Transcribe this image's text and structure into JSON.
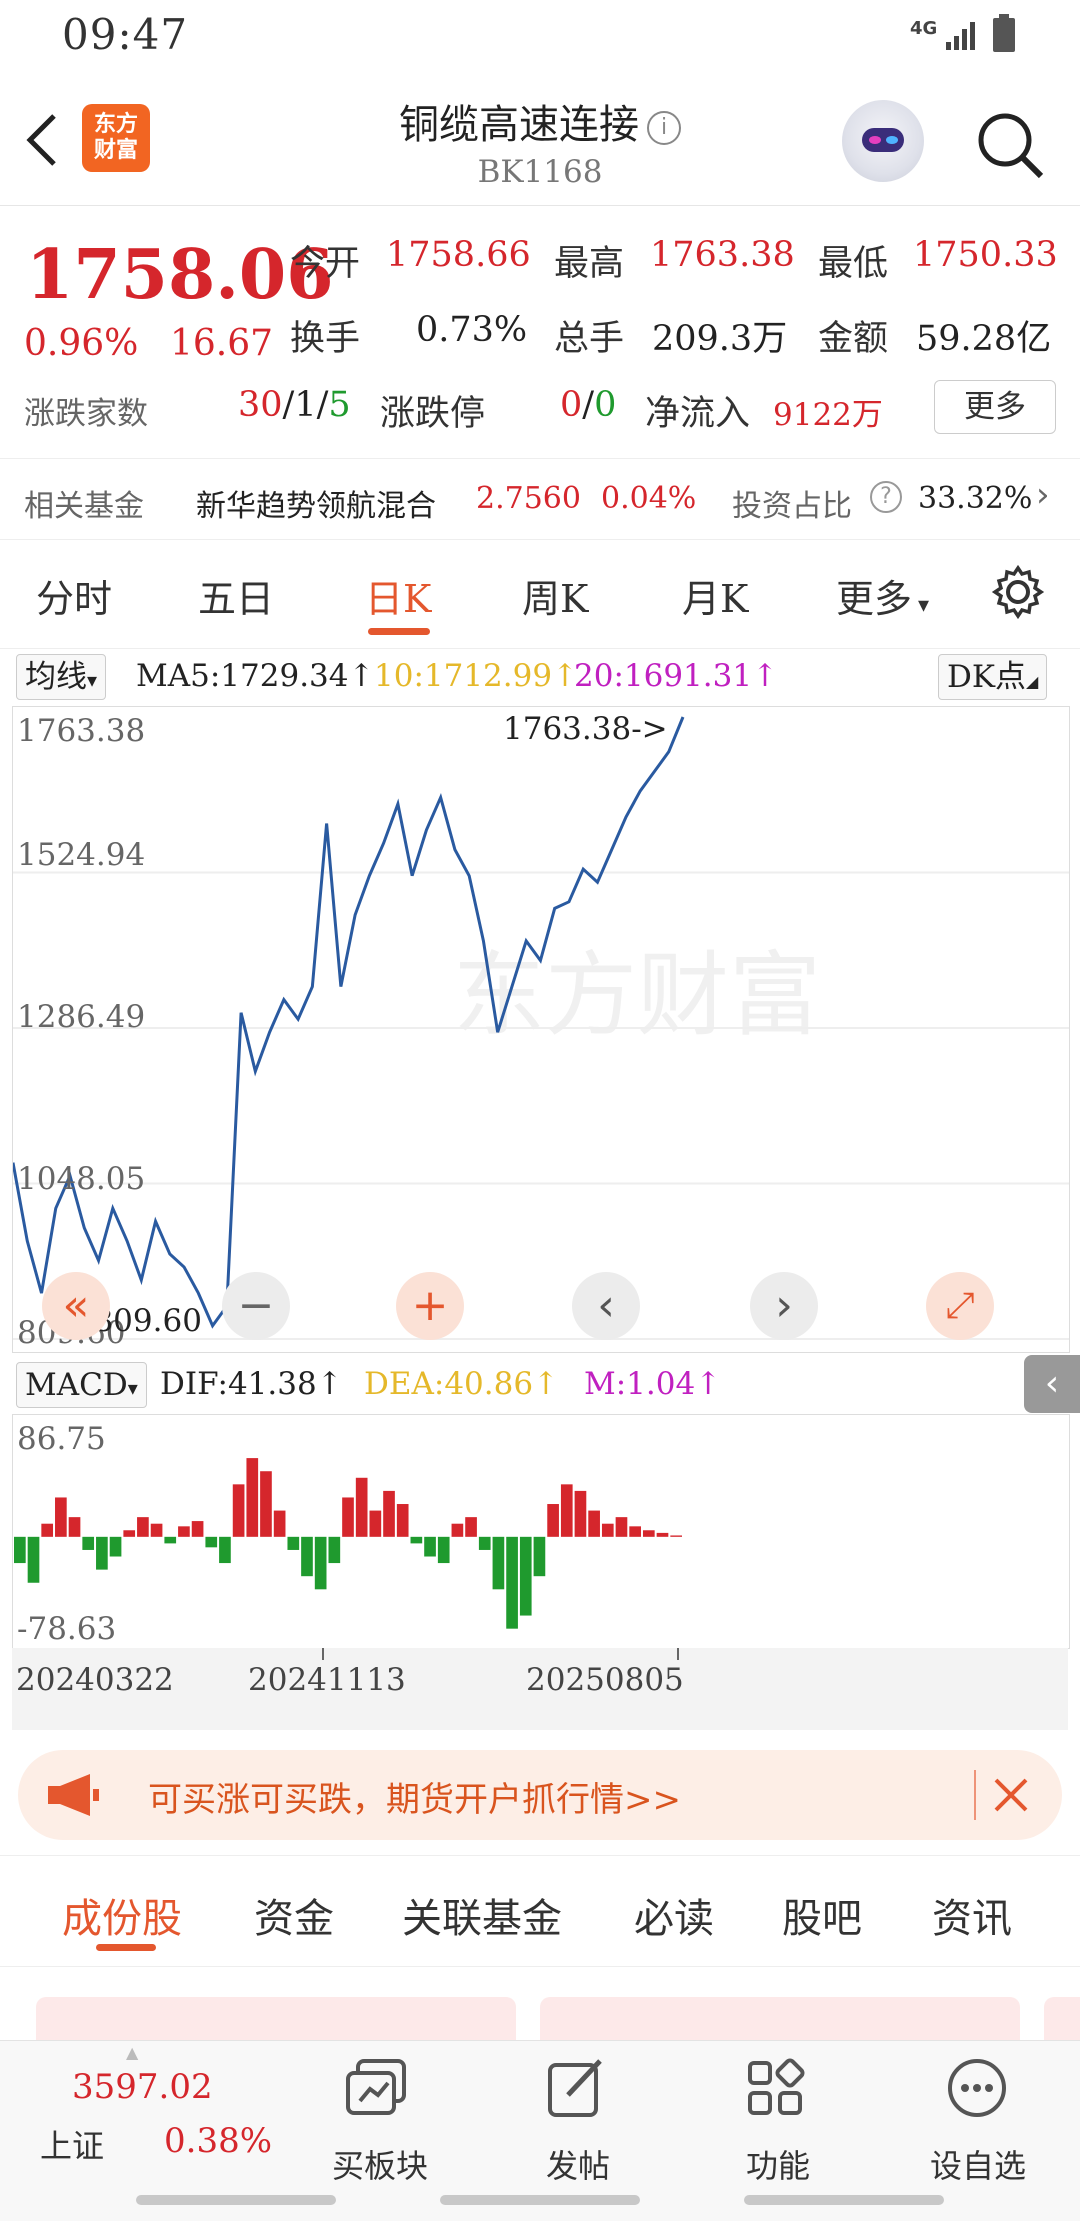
{
  "status": {
    "time": "09:47",
    "network": "4G"
  },
  "header": {
    "title": "铜缆高速连接",
    "code": "BK1168",
    "logo_line1": "东方",
    "logo_line2": "财富"
  },
  "quote": {
    "price": "1758.06",
    "change_pct": "0.96%",
    "change": "16.67",
    "open_label": "今开",
    "open": "1758.66",
    "high_label": "最高",
    "high": "1763.38",
    "low_label": "最低",
    "low": "1750.33",
    "turnover_label": "换手",
    "turnover": "0.73%",
    "volume_label": "总手",
    "volume": "209.3万",
    "amount_label": "金额",
    "amount": "59.28亿",
    "breadth_label": "涨跌家数",
    "breadth_up": "30",
    "breadth_flat": "1",
    "breadth_down": "5",
    "limit_label": "涨跌停",
    "limit_up": "0",
    "limit_down": "0",
    "netflow_label": "净流入",
    "netflow": "9122万",
    "more_label": "更多"
  },
  "fund": {
    "label": "相关基金",
    "name": "新华趋势领航混合",
    "nav": "2.7560",
    "pct": "0.04%",
    "ratio_label": "投资占比",
    "ratio": "33.32%"
  },
  "chart_tabs": [
    "分时",
    "五日",
    "日K",
    "周K",
    "月K",
    "更多"
  ],
  "ma": {
    "select": "均线",
    "ma5": "MA5:1729.34↑",
    "ma10": "10:1712.99↑",
    "ma20": "20:1691.31↑",
    "dk": "DK点"
  },
  "colors": {
    "up": "#d5262c",
    "down": "#1f9a2e",
    "line": "#2a5aa0",
    "ma10": "#e5b82a",
    "accent": "#e4572e",
    "macd_m": "#c020c0"
  },
  "chart_data": [
    {
      "type": "line",
      "title": "",
      "y_ticks": [
        "1763.38",
        "1524.94",
        "1286.49",
        "1048.05",
        "809.60"
      ],
      "ylim": [
        809.6,
        1763.38
      ],
      "max_annotation": "1763.38->",
      "min_annotation": "<-809.60",
      "x": [
        "20240322",
        "20241113",
        "20250805"
      ],
      "series": [
        {
          "values": [
            1080,
            960,
            880,
            1010,
            1060,
            980,
            930,
            1010,
            960,
            900,
            990,
            940,
            920,
            880,
            830,
            860,
            1310,
            1220,
            1280,
            1330,
            1300,
            1350,
            1600,
            1350,
            1460,
            1520,
            1570,
            1630,
            1520,
            1590,
            1640,
            1560,
            1520,
            1420,
            1280,
            1350,
            1420,
            1390,
            1470,
            1480,
            1530,
            1510,
            1560,
            1610,
            1650,
            1680,
            1710,
            1763.38
          ]
        }
      ]
    },
    {
      "type": "bar",
      "title": "",
      "indicator": "MACD",
      "dif": "DIF:41.38↑",
      "dea": "DEA:40.86↑",
      "m": "M:1.04↑",
      "y_ticks": [
        "86.75",
        "-78.63"
      ],
      "ylim": [
        -78.63,
        86.75
      ],
      "values": [
        -20,
        -35,
        10,
        30,
        15,
        -10,
        -25,
        -15,
        5,
        15,
        10,
        -5,
        8,
        12,
        -8,
        -20,
        40,
        60,
        50,
        20,
        -10,
        -30,
        -40,
        -20,
        30,
        45,
        20,
        35,
        25,
        -5,
        -15,
        -20,
        10,
        15,
        -10,
        -40,
        -70,
        -60,
        -30,
        25,
        40,
        35,
        20,
        10,
        15,
        8,
        5,
        3,
        1.04
      ]
    }
  ],
  "banner": {
    "text": "可买涨可买跌，期货开户抓行情>>"
  },
  "sub_tabs": [
    "成份股",
    "资金",
    "关联基金",
    "必读",
    "股吧",
    "资讯"
  ],
  "bottom": {
    "index_value": "3597.02",
    "index_name": "上证",
    "index_pct": "0.38%",
    "items": [
      "买板块",
      "发帖",
      "功能",
      "设自选"
    ]
  }
}
